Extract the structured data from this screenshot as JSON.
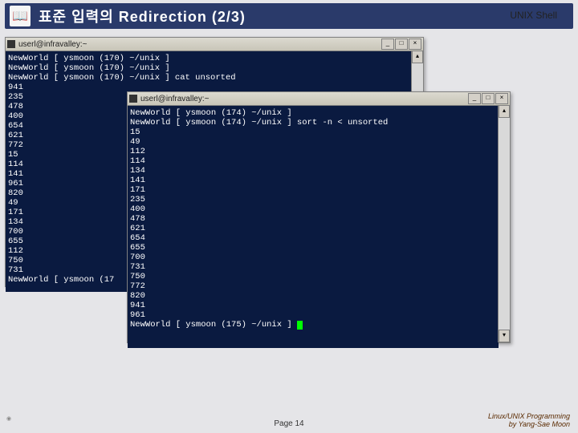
{
  "header": {
    "title": "표준 입력의 Redirection (2/3)",
    "right": "UNIX Shell"
  },
  "term1": {
    "title": "userl@infravalley:~",
    "lines": [
      "NewWorld [ ysmoon (170) ~/unix ]",
      "NewWorld [ ysmoon (170) ~/unix ]",
      "NewWorld [ ysmoon (170) ~/unix ] cat unsorted",
      "941",
      "235",
      "478",
      "400",
      "654",
      "621",
      "772",
      "15",
      "114",
      "141",
      "961",
      "820",
      "49",
      "171",
      "134",
      "700",
      "655",
      "112",
      "750",
      "731",
      "NewWorld [ ysmoon (17"
    ]
  },
  "term2": {
    "title": "userl@infravalley:~",
    "lines": [
      "NewWorld [ ysmoon (174) ~/unix ]",
      "NewWorld [ ysmoon (174) ~/unix ] sort -n < unsorted",
      "15",
      "49",
      "112",
      "114",
      "134",
      "141",
      "171",
      "235",
      "400",
      "478",
      "621",
      "654",
      "655",
      "700",
      "731",
      "750",
      "772",
      "820",
      "941",
      "961",
      "NewWorld [ ysmoon (175) ~/unix ] "
    ]
  },
  "footer": {
    "page": "Page 14",
    "credit_line1": "Linux/UNIX Programming",
    "credit_line2": "by Yang-Sae Moon"
  },
  "window_controls": {
    "min": "_",
    "max": "□",
    "close": "×",
    "up": "▴",
    "down": "▾"
  }
}
